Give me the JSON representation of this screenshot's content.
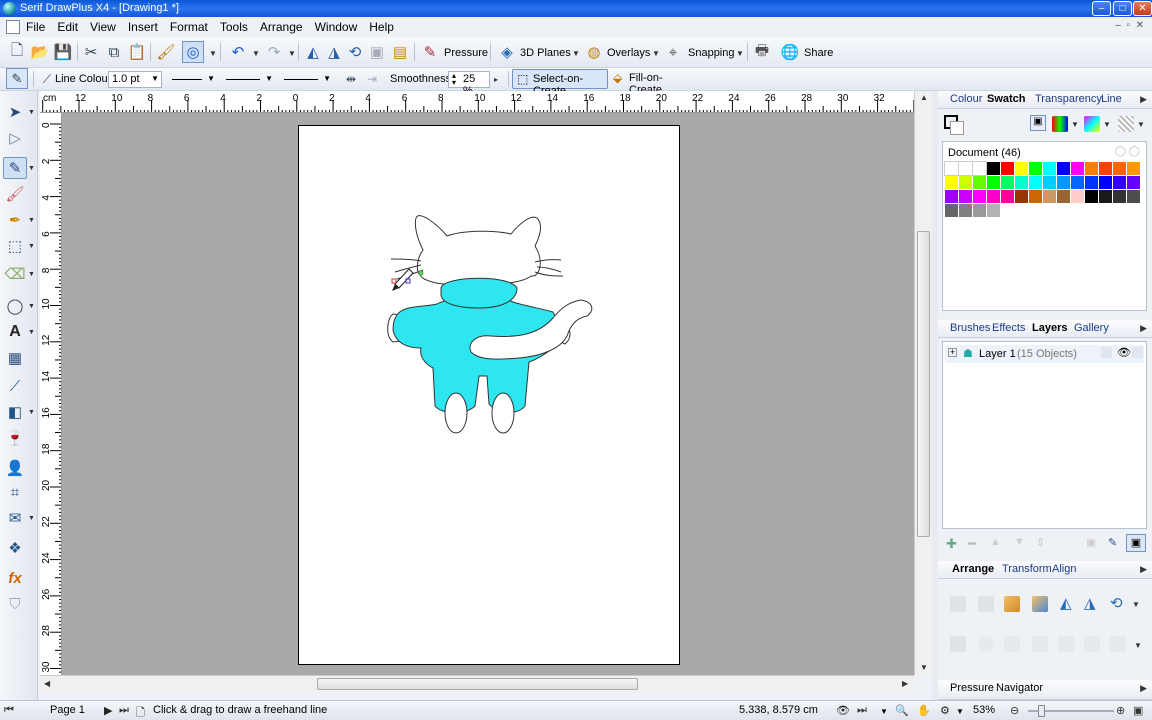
{
  "window": {
    "title": "Serif DrawPlus X4 - [Drawing1 *]"
  },
  "menu": [
    "File",
    "Edit",
    "View",
    "Insert",
    "Format",
    "Tools",
    "Arrange",
    "Window",
    "Help"
  ],
  "toolbar": {
    "pressure": "Pressure",
    "planes": "3D Planes",
    "overlays": "Overlays",
    "snapping": "Snapping",
    "share": "Share"
  },
  "context_bar": {
    "line_colour": "Line Colour",
    "line_width": "1.0 pt",
    "smoothness_label": "Smoothness",
    "smoothness_value": "25 %",
    "select_on_create": "Select-on-Create",
    "fill_on_create": "Fill-on-Create"
  },
  "ruler": {
    "unit": "cm",
    "h_ticks": [
      "12",
      "10",
      "8",
      "6",
      "4",
      "2",
      "0",
      "2",
      "4",
      "6",
      "8",
      "10",
      "12",
      "14",
      "16",
      "18",
      "20",
      "22",
      "24",
      "26",
      "28",
      "30",
      "32"
    ],
    "v_ticks": [
      "0",
      "2",
      "4",
      "6",
      "8",
      "10",
      "12",
      "14",
      "16",
      "18",
      "20",
      "22",
      "24",
      "26",
      "28",
      "30"
    ]
  },
  "panel_top": {
    "tabs": [
      "Colour",
      "Swatch",
      "Transparency",
      "Line"
    ],
    "active": "Swatch",
    "palette_name": "Document (46)",
    "swatches": [
      "#ffffff",
      "#ffffff",
      "#ffffff",
      "#000000",
      "#ff0000",
      "#ffff00",
      "#00ff00",
      "#00ffff",
      "#0000ff",
      "#ff00ff",
      "#ff8000",
      "#ff4000",
      "#ff6600",
      "#ff9900",
      "#ffff00",
      "#ccff00",
      "#66ff00",
      "#00ff00",
      "#00ff66",
      "#00ffcc",
      "#00ffff",
      "#00ccff",
      "#0099ff",
      "#0066ff",
      "#0033ff",
      "#0000ff",
      "#3300ff",
      "#6600ff",
      "#9900ff",
      "#cc00ff",
      "#ff00ff",
      "#ff00cc",
      "#ff0099",
      "#993300",
      "#cc6600",
      "#cc9966",
      "#996633",
      "#ffcccc",
      "#000000",
      "#1a1a1a",
      "#333333",
      "#4d4d4d",
      "#666666",
      "#808080",
      "#999999",
      "#b3b3b3"
    ]
  },
  "panel_mid": {
    "tabs": [
      "Brushes",
      "Effects",
      "Layers",
      "Gallery"
    ],
    "active": "Layers",
    "layer_name": "Layer 1",
    "layer_count": "(15 Objects)"
  },
  "panel_arrange": {
    "tabs": [
      "Arrange",
      "Transform",
      "Align"
    ],
    "active": "Arrange"
  },
  "panel_bottom": {
    "tabs": [
      "Pressure",
      "Navigator"
    ]
  },
  "status": {
    "page": "Page 1",
    "hint": "Click & drag to draw a freehand line",
    "coords": "5.338,  8.579 cm",
    "zoom": "53%"
  },
  "colors": {
    "cat_fill": "#2ee6f0",
    "title_bar": "#1e63e4",
    "canvas_bg": "#aaa8ab"
  }
}
